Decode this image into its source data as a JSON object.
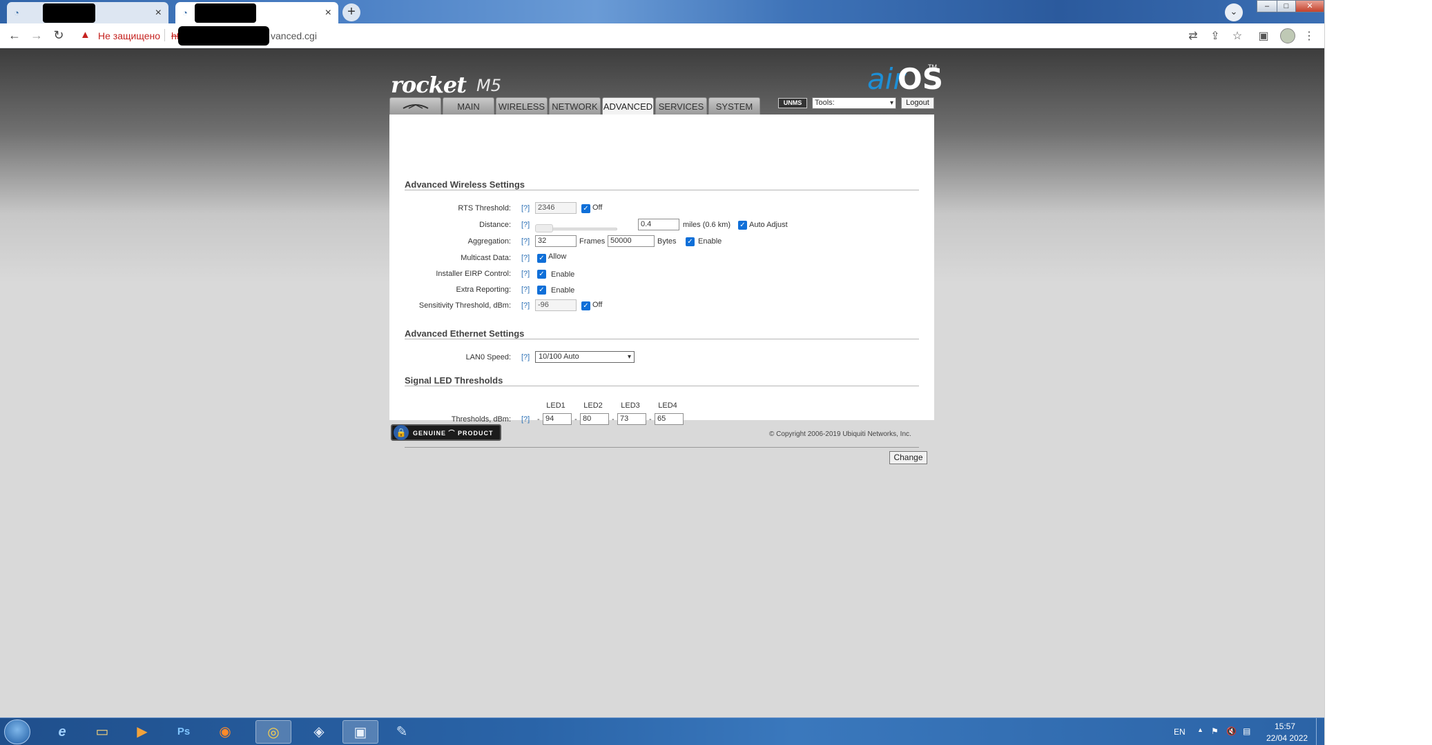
{
  "browser": {
    "tab_close": "×",
    "new_tab": "+",
    "tab_search": "⌄",
    "back": "←",
    "forward": "→",
    "reload": "↻",
    "warning": "▲",
    "insecure_label": "Не защищено",
    "url_protocol": "http",
    "url_path": "vanced.cgi",
    "win_min": "–",
    "win_max": "□",
    "win_close": "✕"
  },
  "logo": {
    "product": "rocket",
    "model": "M5",
    "brand_air": "air",
    "brand_os": "OS",
    "tm": "TM"
  },
  "nav": {
    "tabs": [
      {
        "label": "MAIN"
      },
      {
        "label": "WIRELESS"
      },
      {
        "label": "NETWORK"
      },
      {
        "label": "ADVANCED"
      },
      {
        "label": "SERVICES"
      },
      {
        "label": "SYSTEM"
      }
    ],
    "active": "ADVANCED"
  },
  "header_tools": {
    "unms": "UNMS",
    "tools_value": "Tools:",
    "logout": "Logout",
    "arrow": "▾"
  },
  "sections": {
    "wireless": "Advanced Wireless Settings",
    "ethernet": "Advanced Ethernet Settings",
    "led": "Signal LED Thresholds"
  },
  "help": "[?]",
  "check": "✓",
  "fields": {
    "rts": {
      "label": "RTS Threshold:",
      "value": "2346",
      "check_label": "Off"
    },
    "distance": {
      "label": "Distance:",
      "value": "0.4",
      "unit": "miles (0.6 km)",
      "check_label": "Auto Adjust"
    },
    "aggregation": {
      "label": "Aggregation:",
      "frames_value": "32",
      "frames_label": "Frames",
      "bytes_value": "50000",
      "bytes_label": "Bytes",
      "check_label": "Enable"
    },
    "multicast": {
      "label": "Multicast Data:",
      "check_label": "Allow"
    },
    "eirp": {
      "label": "Installer EIRP Control:",
      "check_label": "Enable"
    },
    "extra": {
      "label": "Extra Reporting:",
      "check_label": "Enable"
    },
    "sensitivity": {
      "label": "Sensitivity Threshold, dBm:",
      "value": "-96",
      "check_label": "Off"
    },
    "lan0": {
      "label": "LAN0 Speed:",
      "value": "10/100 Auto"
    },
    "thresholds": {
      "label": "Thresholds, dBm:",
      "dash": "-",
      "leds": [
        {
          "name": "LED1",
          "value": "94"
        },
        {
          "name": "LED2",
          "value": "80"
        },
        {
          "name": "LED3",
          "value": "73"
        },
        {
          "name": "LED4",
          "value": "65"
        }
      ]
    }
  },
  "change_button": "Change",
  "footer": {
    "genuine_lock": "🔒",
    "genuine": "GENUINE ⌒ PRODUCT",
    "copyright": "© Copyright 2006-2019 Ubiquiti Networks, Inc."
  },
  "taskbar": {
    "lang": "EN",
    "tray_up": "▲",
    "tray_flag": "⚑",
    "tray_sound": "🔇",
    "tray_network": "▤",
    "time": "15:57",
    "date": "22/04 2022",
    "apps": [
      {
        "icon": "e"
      },
      {
        "icon": "▭"
      },
      {
        "icon": "▶"
      },
      {
        "icon": "Ps"
      },
      {
        "icon": "◉"
      },
      {
        "icon": "◎"
      },
      {
        "icon": "◈"
      },
      {
        "icon": "▣"
      },
      {
        "icon": "✎"
      }
    ]
  }
}
